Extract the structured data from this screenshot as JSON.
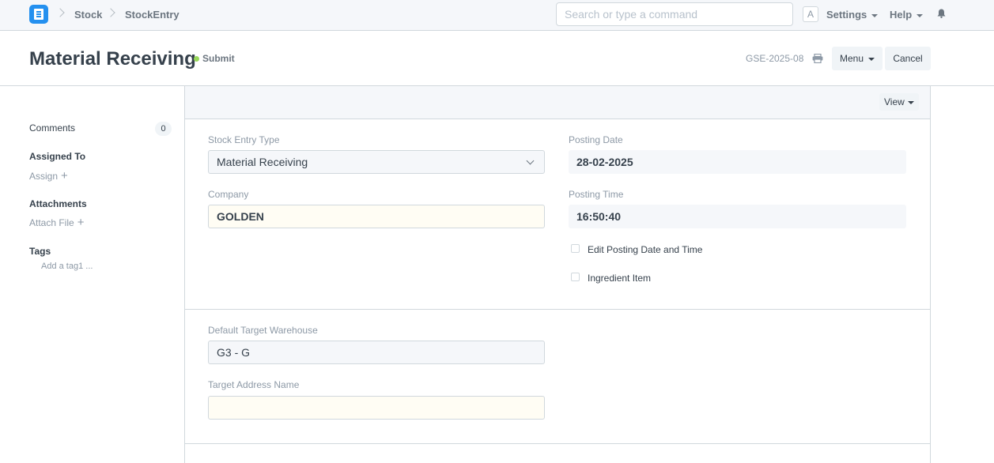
{
  "navbar": {
    "breadcrumbs": [
      "Stock",
      "StockEntry"
    ],
    "search_placeholder": "Search or type a command",
    "avatar_letter": "A",
    "settings_label": "Settings",
    "help_label": "Help"
  },
  "page": {
    "title": "Material Receiving",
    "status": "Submit",
    "status_color": "#98d85b",
    "docname": "GSE-2025-08",
    "menu_label": "Menu",
    "cancel_label": "Cancel"
  },
  "sidebar": {
    "comments_label": "Comments",
    "comments_count": "0",
    "assigned_head": "Assigned To",
    "assign_link": "Assign",
    "attachments_head": "Attachments",
    "attach_link": "Attach File",
    "tags_head": "Tags",
    "tag_placeholder": "Add a tag1 ..."
  },
  "form": {
    "view_label": "View",
    "stock_entry_type_label": "Stock Entry Type",
    "stock_entry_type_value": "Material Receiving",
    "company_label": "Company",
    "company_value": "GOLDEN",
    "posting_date_label": "Posting Date",
    "posting_date_value": "28-02-2025",
    "posting_time_label": "Posting Time",
    "posting_time_value": "16:50:40",
    "edit_posting_label": "Edit Posting Date and Time",
    "ingredient_item_label": "Ingredient Item",
    "default_target_label": "Default Target Warehouse",
    "default_target_value": "G3 - G",
    "target_address_label": "Target Address Name",
    "target_address_value": ""
  }
}
